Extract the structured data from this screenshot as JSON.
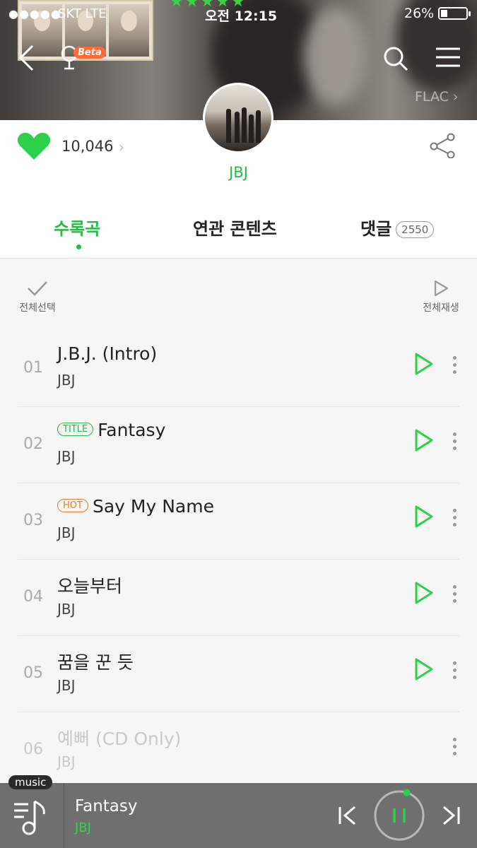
{
  "status_bar": {
    "carrier": "SKT LTE",
    "rating_stars": "★★★★★",
    "time": "오전 12:15",
    "battery_percent": "26%",
    "battery_level": 0.26
  },
  "header": {
    "beta_label": "Beta",
    "quality_label": "FLAC ›",
    "icons": [
      "back-icon",
      "voice-mic-icon",
      "search-icon",
      "menu-icon"
    ]
  },
  "album": {
    "likes": "10,046",
    "artist": "JBJ",
    "icons": [
      "heart-icon",
      "share-icon"
    ]
  },
  "tabs": [
    {
      "label": "수록곡",
      "active": true
    },
    {
      "label": "연관 콘텐츠",
      "active": false
    },
    {
      "label": "댓글",
      "badge": "2550",
      "active": false
    }
  ],
  "controls": {
    "select_all": "전체선택",
    "play_all": "전체재생"
  },
  "tracks": [
    {
      "num": "01",
      "tag": "",
      "title": "J.B.J. (Intro)",
      "artist": "JBJ",
      "faded": false
    },
    {
      "num": "02",
      "tag": "TITLE",
      "title": "Fantasy",
      "artist": "JBJ",
      "faded": false
    },
    {
      "num": "03",
      "tag": "HOT",
      "title": "Say My Name",
      "artist": "JBJ",
      "faded": false
    },
    {
      "num": "04",
      "tag": "",
      "title": "오늘부터",
      "artist": "JBJ",
      "faded": false
    },
    {
      "num": "05",
      "tag": "",
      "title": "꿈을 꾼 듯",
      "artist": "JBJ",
      "faded": false
    },
    {
      "num": "06",
      "tag": "",
      "title": "예뻐 (CD Only)",
      "artist": "JBJ",
      "faded": true
    }
  ],
  "player": {
    "chip": "music",
    "song": "Fantasy",
    "artist": "JBJ",
    "progress": 0.05
  },
  "colors": {
    "accent_green": "#2bb84a",
    "hot_orange": "#ec7a2c",
    "player_bg": "#6f6f6f"
  }
}
